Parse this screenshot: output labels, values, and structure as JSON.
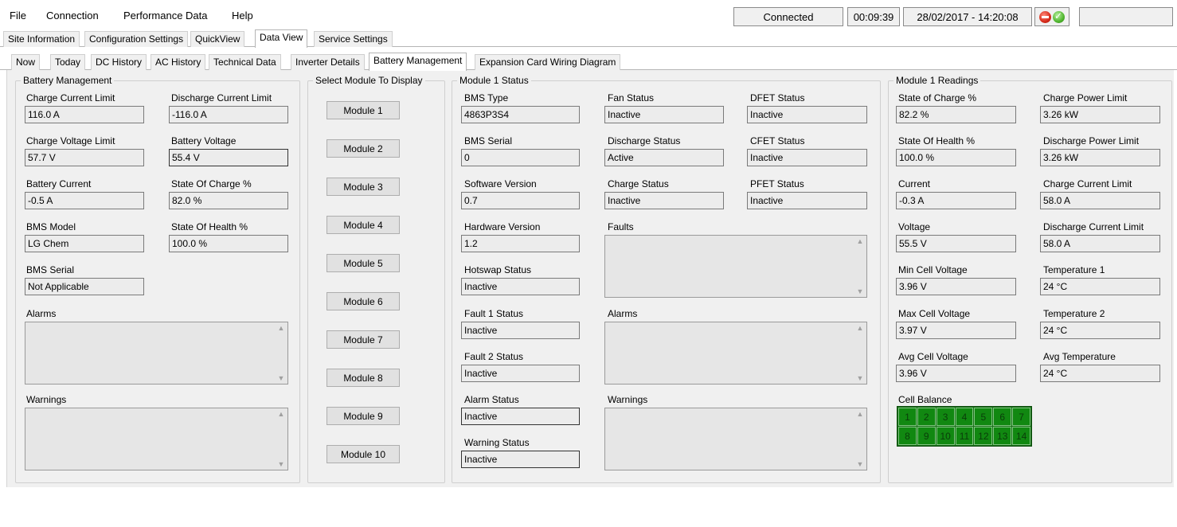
{
  "menu": {
    "items": [
      "File",
      "Connection",
      "Performance Data",
      "Help"
    ]
  },
  "status": {
    "connection": "Connected",
    "elapsed": "00:09:39",
    "datetime": "28/02/2017 - 14:20:08",
    "icons": [
      "stop-icon",
      "ok-icon"
    ]
  },
  "tabs_main": [
    "Site Information",
    "Configuration Settings",
    "QuickView",
    "Data View",
    "Service Settings"
  ],
  "tabs_main_active": "Data View",
  "tabs_sub": [
    "Now",
    "Today",
    "DC History",
    "AC History",
    "Technical Data",
    "Inverter Details",
    "Battery Management",
    "Expansion Card Wiring Diagram"
  ],
  "tabs_sub_active": "Battery Management",
  "battery": {
    "title": "Battery Management",
    "charge_current_limit_label": "Charge Current Limit",
    "charge_current_limit": "116.0 A",
    "discharge_current_limit_label": "Discharge Current Limit",
    "discharge_current_limit": "-116.0 A",
    "charge_voltage_limit_label": "Charge Voltage Limit",
    "charge_voltage_limit": "57.7 V",
    "battery_voltage_label": "Battery Voltage",
    "battery_voltage": "55.4 V",
    "battery_current_label": "Battery Current",
    "battery_current": "-0.5 A",
    "soc_label": "State Of Charge %",
    "soc": "82.0 %",
    "bms_model_label": "BMS Model",
    "bms_model": "LG Chem",
    "soh_label": "State Of Health %",
    "soh": "100.0 %",
    "bms_serial_label": "BMS Serial",
    "bms_serial": "Not Applicable",
    "alarms_label": "Alarms",
    "warnings_label": "Warnings"
  },
  "select_module": {
    "title": "Select Module To Display",
    "buttons": [
      "Module 1",
      "Module 2",
      "Module 3",
      "Module 4",
      "Module 5",
      "Module 6",
      "Module 7",
      "Module 8",
      "Module 9",
      "Module 10"
    ]
  },
  "module_status": {
    "title": "Module 1 Status",
    "bms_type_label": "BMS Type",
    "bms_type": "4863P3S4",
    "bms_serial_label": "BMS Serial",
    "bms_serial": "0",
    "software_version_label": "Software Version",
    "software_version": "0.7",
    "hardware_version_label": "Hardware Version",
    "hardware_version": "1.2",
    "hotswap_label": "Hotswap Status",
    "hotswap": "Inactive",
    "fault1_label": "Fault 1 Status",
    "fault1": "Inactive",
    "fault2_label": "Fault 2 Status",
    "fault2": "Inactive",
    "alarm_status_label": "Alarm Status",
    "alarm_status": "Inactive",
    "warning_status_label": "Warning Status",
    "warning_status": "Inactive",
    "fan_label": "Fan Status",
    "fan": "Inactive",
    "discharge_label": "Discharge Status",
    "discharge": "Active",
    "charge_label": "Charge Status",
    "charge": "Inactive",
    "dfet_label": "DFET Status",
    "dfet": "Inactive",
    "cfet_label": "CFET Status",
    "cfet": "Inactive",
    "pfet_label": "PFET Status",
    "pfet": "Inactive",
    "faults_label": "Faults",
    "alarms_label": "Alarms",
    "warnings_label": "Warnings"
  },
  "module_readings": {
    "title": "Module 1 Readings",
    "soc_label": "State of Charge %",
    "soc": "82.2 %",
    "soh_label": "State Of Health %",
    "soh": "100.0 %",
    "current_label": "Current",
    "current": "-0.3 A",
    "voltage_label": "Voltage",
    "voltage": "55.5 V",
    "min_cell_label": "Min Cell Voltage",
    "min_cell": "3.96 V",
    "max_cell_label": "Max Cell Voltage",
    "max_cell": "3.97 V",
    "avg_cell_label": "Avg Cell Voltage",
    "avg_cell": "3.96 V",
    "charge_power_limit_label": "Charge Power Limit",
    "charge_power_limit": "3.26 kW",
    "discharge_power_limit_label": "Discharge Power Limit",
    "discharge_power_limit": "3.26 kW",
    "charge_current_limit_label": "Charge Current Limit",
    "charge_current_limit": "58.0 A",
    "discharge_current_limit_label": "Discharge Current Limit",
    "discharge_current_limit": "58.0 A",
    "temp1_label": "Temperature 1",
    "temp1": "24 °C",
    "temp2_label": "Temperature 2",
    "temp2": "24 °C",
    "avg_temp_label": "Avg Temperature",
    "avg_temp": "24 °C",
    "cell_balance_label": "Cell Balance",
    "cells": [
      "1",
      "2",
      "3",
      "4",
      "5",
      "6",
      "7",
      "8",
      "9",
      "10",
      "11",
      "12",
      "13",
      "14"
    ],
    "cell_color": "#118811"
  }
}
